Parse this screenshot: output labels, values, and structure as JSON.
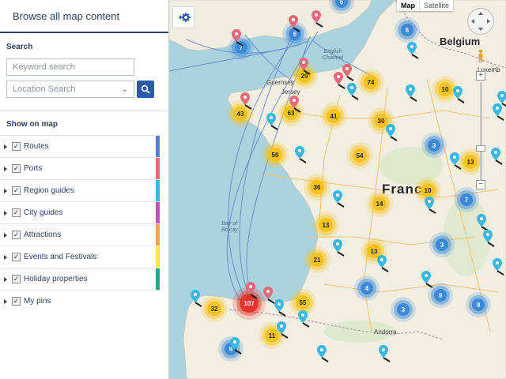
{
  "sidebar": {
    "title": "Browse all map content",
    "search_label": "Search",
    "keyword_placeholder": "Keyword search",
    "location_placeholder": "Location Search",
    "show_label": "Show on map",
    "layers": [
      {
        "label": "Routes",
        "checked": true,
        "color": "#5b7ec8"
      },
      {
        "label": "Ports",
        "checked": true,
        "color": "#e56b7a"
      },
      {
        "label": "Region guides",
        "checked": true,
        "color": "#39b8e6"
      },
      {
        "label": "City guides",
        "checked": true,
        "color": "#b05ca6"
      },
      {
        "label": "Attractions",
        "checked": true,
        "color": "#f3a45c"
      },
      {
        "label": "Events and Festivals",
        "checked": true,
        "color": "#f2e74b"
      },
      {
        "label": "Holiday properties",
        "checked": true,
        "color": "#2aa68b"
      },
      {
        "label": "My pins",
        "checked": true,
        "color": ""
      }
    ]
  },
  "map": {
    "type_active": "Map",
    "type_other": "Satellite",
    "labels": {
      "belgium": "Belgium",
      "france": "Franc",
      "luxembourg": "Luxemb",
      "guernsey": "Guernsey",
      "jersey": "Jersey",
      "channel": "English\nChannel",
      "biscay": "Bay of\nBiscay",
      "andorra": "Andorra"
    },
    "clusters": {
      "yellow": [
        "29",
        "74",
        "43",
        "63",
        "41",
        "30",
        "10",
        "50",
        "54",
        "36",
        "14",
        "10",
        "13",
        "13",
        "13",
        "21",
        "55",
        "32",
        "11"
      ],
      "blue": [
        "5",
        "6",
        "7",
        "6",
        "3",
        "7",
        "3",
        "4",
        "3",
        "9",
        "9",
        "6"
      ],
      "red": [
        "107"
      ]
    }
  },
  "colors": {
    "brand": "#2a3f6b",
    "go_button": "#2a5aa8",
    "cluster_yellow": "#f6c31d",
    "cluster_blue": "#3b8ad9",
    "cluster_red": "#e8362f"
  }
}
